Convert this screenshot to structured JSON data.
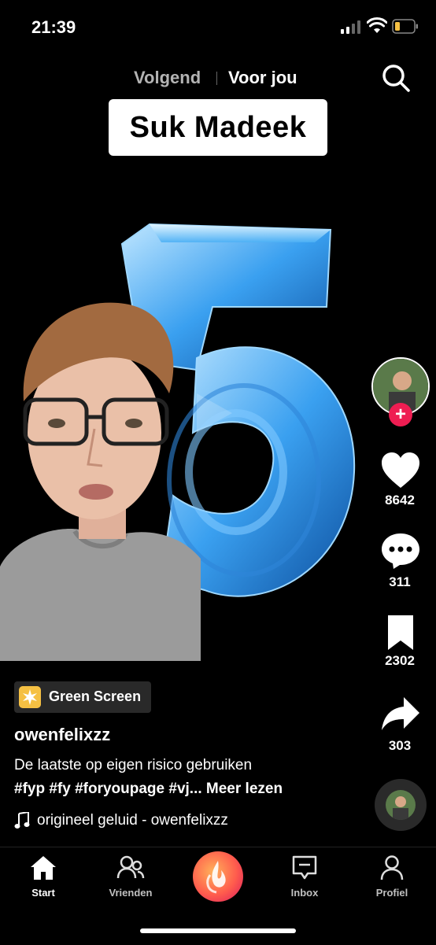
{
  "status": {
    "time": "21:39"
  },
  "top_nav": {
    "following": "Volgend",
    "for_you": "Voor jou"
  },
  "video": {
    "title_overlay": "Suk Madeek"
  },
  "right_rail": {
    "likes": "8642",
    "comments": "311",
    "saves": "2302",
    "shares": "303"
  },
  "info": {
    "effect": "Green Screen",
    "username": "owenfelixzz",
    "caption": "De laatste op eigen risico gebruiken",
    "hashtags": "#fyp #fy #foryoupage #vj... Meer lezen",
    "sound": "origineel geluid - owenfelixzz"
  },
  "tabbar": {
    "home": "Start",
    "friends": "Vrienden",
    "inbox": "Inbox",
    "profile": "Profiel"
  },
  "colors": {
    "accent": "#ee1d52",
    "effect_badge": "#f5c043",
    "digit_blue": "#3aa0f0"
  }
}
